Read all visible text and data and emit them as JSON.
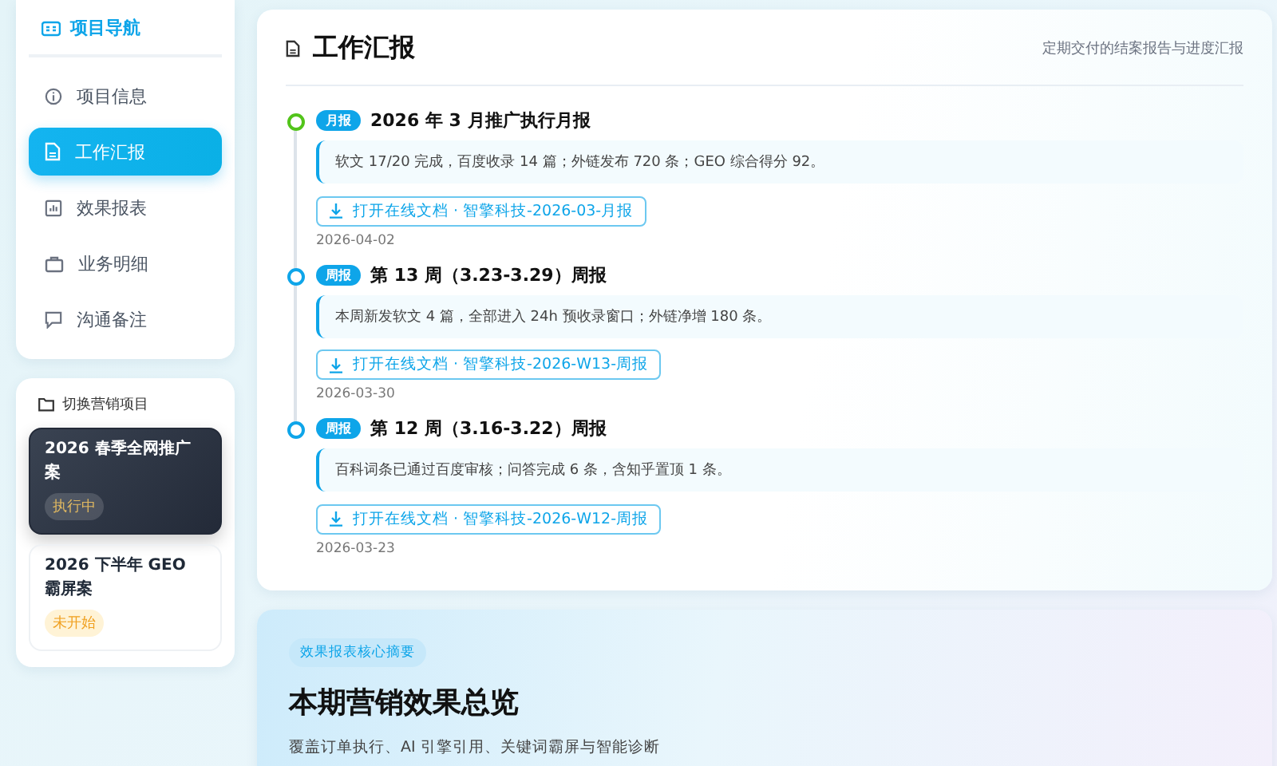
{
  "sidebar": {
    "title": "项目导航",
    "items": [
      {
        "label": "项目信息",
        "selected": false
      },
      {
        "label": "工作汇报",
        "selected": true
      },
      {
        "label": "效果报表",
        "selected": false
      },
      {
        "label": "业务明细",
        "selected": false
      },
      {
        "label": "沟通备注",
        "selected": false
      }
    ]
  },
  "projects": {
    "title": "切换营销项目",
    "items": [
      {
        "name": "2026 春季全网推广案",
        "status": "执行中",
        "selected": true
      },
      {
        "name": "2026 下半年 GEO 霸屏案",
        "status": "未开始",
        "selected": false
      }
    ]
  },
  "reports": {
    "title": "工作汇报",
    "subtitle": "定期交付的结案报告与进度汇报",
    "items": [
      {
        "tag": "月报",
        "title": "2026 年 3 月推广执行月报",
        "summary": "软文 17/20 完成，百度收录 14 篇；外链发布 720 条；GEO 综合得分 92。",
        "link": "打开在线文档 · 智擎科技-2026-03-月报",
        "date": "2026-04-02",
        "color": "#52c41a"
      },
      {
        "tag": "周报",
        "title": "第 13 周（3.23-3.29）周报",
        "summary": "本周新发软文 4 篇，全部进入 24h 预收录窗口；外链净增 180 条。",
        "link": "打开在线文档 · 智擎科技-2026-W13-周报",
        "date": "2026-03-30",
        "color": "#0ea5e9"
      },
      {
        "tag": "周报",
        "title": "第 12 周（3.16-3.22）周报",
        "summary": "百科词条已通过百度审核；问答完成 6 条，含知乎置顶 1 条。",
        "link": "打开在线文档 · 智擎科技-2026-W12-周报",
        "date": "2026-03-23",
        "color": "#0ea5e9"
      }
    ]
  },
  "overview": {
    "badge": "效果报表核心摘要",
    "title": "本期营销效果总览",
    "subtitle": "覆盖订单执行、AI 引擎引用、关键词霸屏与智能诊断"
  }
}
